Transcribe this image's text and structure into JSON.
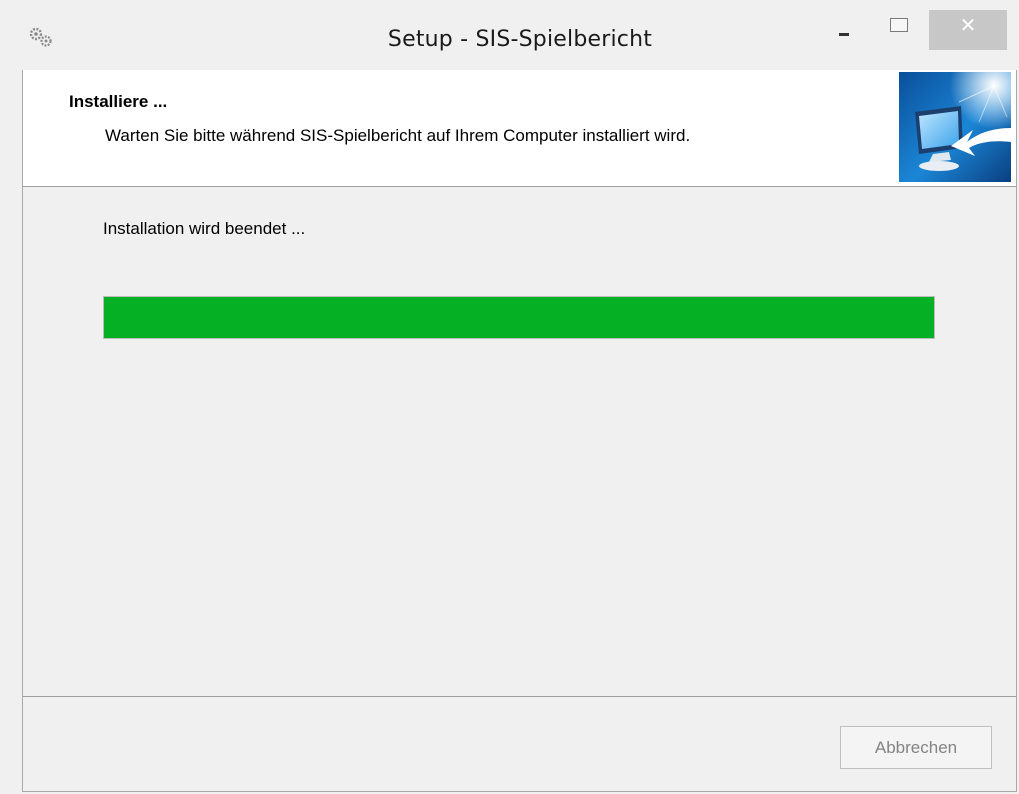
{
  "window": {
    "title": "Setup - SIS-Spielbericht",
    "close_glyph": "✕"
  },
  "header": {
    "title": "Installiere ...",
    "subtitle": "Warten Sie bitte während SIS-Spielbericht auf Ihrem Computer installiert wird.",
    "image_icon": "computer-install-icon"
  },
  "main": {
    "status_text": "Installation wird beendet ...",
    "progress_percent": 100
  },
  "footer": {
    "cancel_label": "Abbrechen"
  },
  "colors": {
    "progress_fill": "#06b025",
    "close_button_bg": "#c7c7c7",
    "window_bg": "#f0f0f0"
  }
}
